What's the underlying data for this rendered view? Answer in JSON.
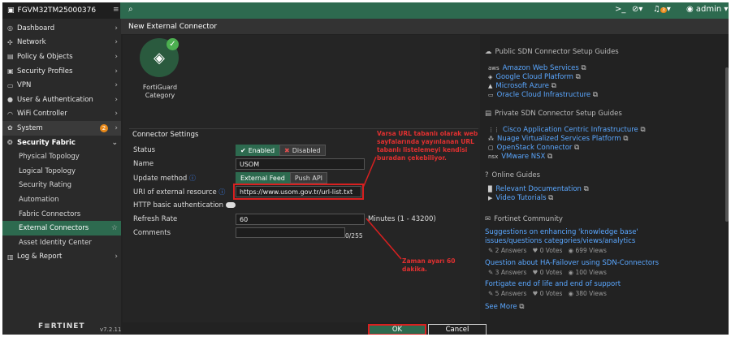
{
  "topbar": {
    "hostname": "FGVM32TM25000376",
    "menu_icon": "menu-icon",
    "search_icon": "search-icon",
    "cli_icon": ">_",
    "help_icon": "?",
    "bell_count": "3",
    "user": "admin"
  },
  "sidebar": {
    "items": [
      {
        "label": "Dashboard",
        "icon": "dashboard-icon"
      },
      {
        "label": "Network",
        "icon": "network-icon"
      },
      {
        "label": "Policy & Objects",
        "icon": "policy-icon"
      },
      {
        "label": "Security Profiles",
        "icon": "lock-icon"
      },
      {
        "label": "VPN",
        "icon": "vpn-icon"
      },
      {
        "label": "User & Authentication",
        "icon": "user-icon"
      },
      {
        "label": "WiFi Controller",
        "icon": "wifi-icon"
      },
      {
        "label": "System",
        "icon": "gear-icon",
        "badge": "2"
      },
      {
        "label": "Security Fabric",
        "icon": "fabric-icon"
      }
    ],
    "sub": [
      "Physical Topology",
      "Logical Topology",
      "Security Rating",
      "Automation",
      "Fabric Connectors",
      "External Connectors",
      "Asset Identity Center"
    ],
    "last": "Log & Report",
    "logo": "F≡RTINET",
    "version": "v7.2.11"
  },
  "main": {
    "title": "New External Connector",
    "card_label_1": "FortiGuard",
    "card_label_2": "Category",
    "section": "Connector Settings",
    "status_label": "Status",
    "status_enabled": "Enabled",
    "status_disabled": "Disabled",
    "name_label": "Name",
    "name_value": "USOM",
    "update_label": "Update method",
    "update_feed": "External Feed",
    "update_push": "Push API",
    "uri_label": "URI of external resource",
    "uri_value": "https://www.usom.gov.tr/url-list.txt",
    "http_label": "HTTP basic authentication",
    "refresh_label": "Refresh Rate",
    "refresh_value": "60",
    "refresh_unit": "Minutes (1 - 43200)",
    "comments_label": "Comments",
    "comments_count": "0/255",
    "callout1": "Varsa URL tabanlı olarak web sayfalarında yayınlanan URL tabanlı listelemeyi kendisi buradan çekebiliyor.",
    "callout2": "Zaman ayarı 60 dakika."
  },
  "right": {
    "public_head": "Public SDN Connector Setup Guides",
    "public": [
      "Amazon Web Services",
      "Google Cloud Platform",
      "Microsoft Azure",
      "Oracle Cloud Infrastructure"
    ],
    "private_head": "Private SDN Connector Setup Guides",
    "private": [
      "Cisco Application Centric Infrastructure",
      "Nuage Virtualized Services Platform",
      "OpenStack Connector",
      "VMware NSX"
    ],
    "online_head": "Online Guides",
    "online": [
      "Relevant Documentation",
      "Video Tutorials"
    ],
    "community_head": "Fortinet Community",
    "posts": [
      {
        "title": "Suggestions on enhancing 'knowledge base' issues/questions categories/views/analytics",
        "answers": "2 Answers",
        "votes": "0 Votes",
        "views": "699 Views"
      },
      {
        "title": "Question about HA-Failover using SDN-Connectors",
        "answers": "3 Answers",
        "votes": "0 Votes",
        "views": "100 Views"
      },
      {
        "title": "Fortigate end of life and end of support",
        "answers": "5 Answers",
        "votes": "0 Votes",
        "views": "380 Views"
      }
    ],
    "see_more": "See More"
  },
  "buttons": {
    "ok": "OK",
    "cancel": "Cancel"
  },
  "colors": {
    "accent": "#2d6a4f",
    "callout": "#e03030",
    "link": "#5aa7ff"
  }
}
